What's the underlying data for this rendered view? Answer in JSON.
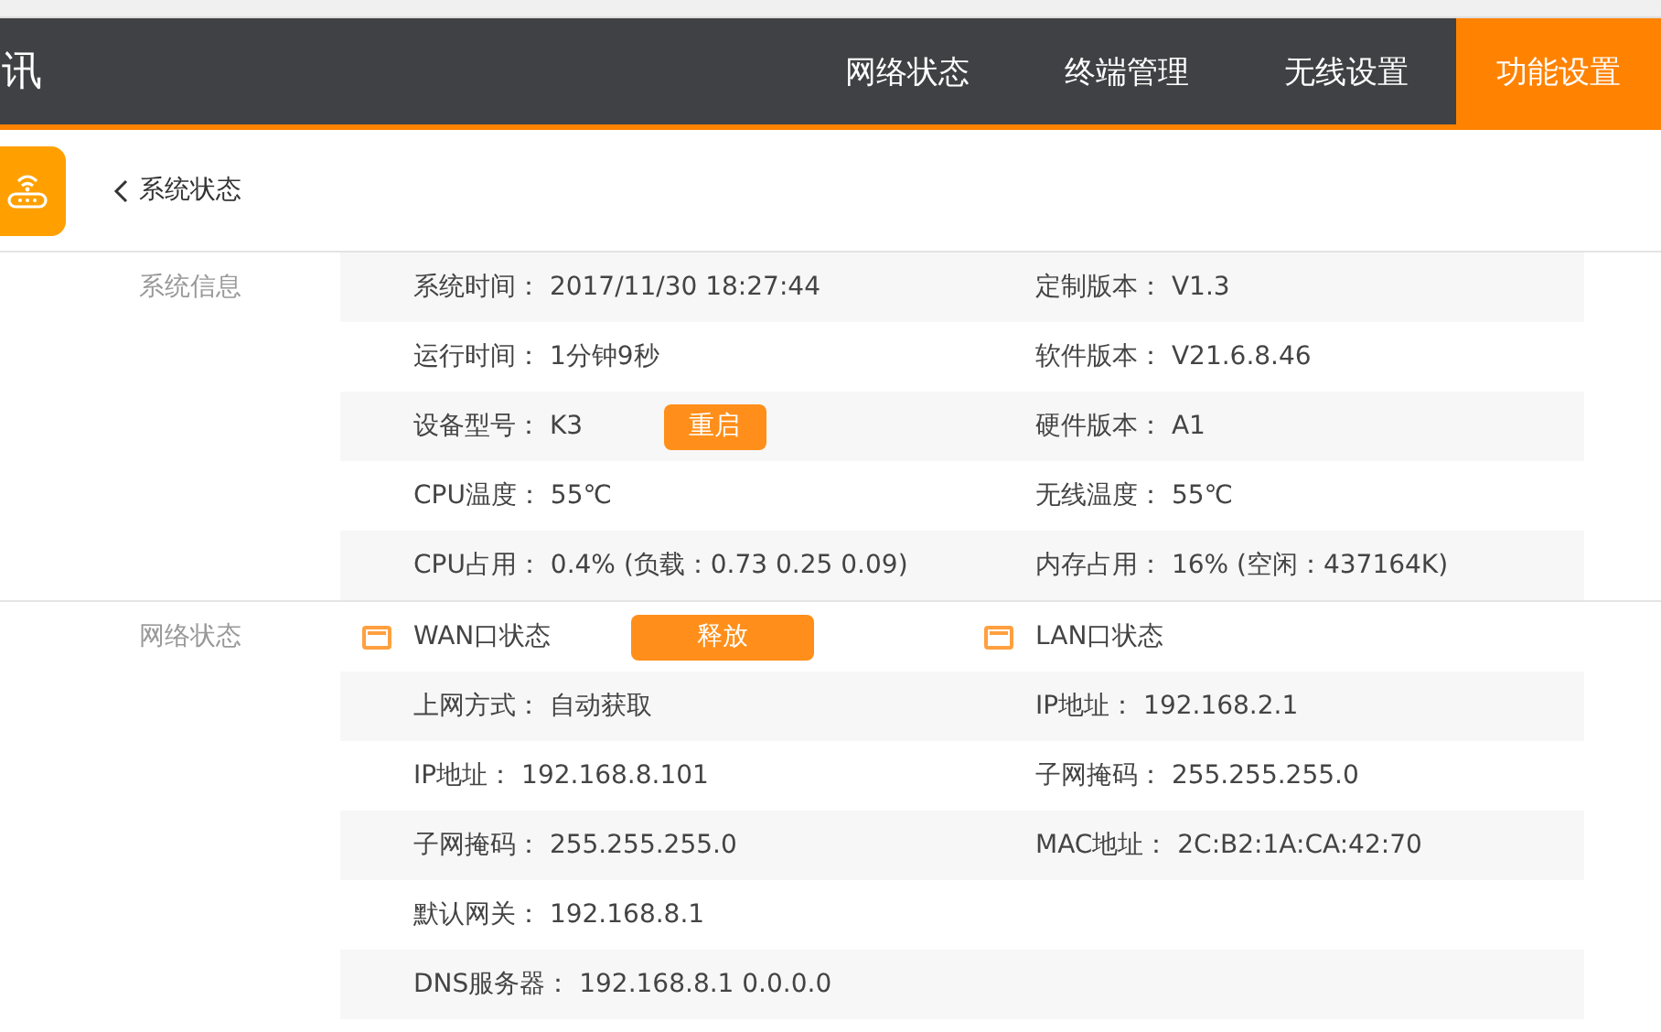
{
  "header": {
    "logo": "讯",
    "nav": [
      {
        "label": "网络状态",
        "selected": false
      },
      {
        "label": "终端管理",
        "selected": false
      },
      {
        "label": "无线设置",
        "selected": false
      },
      {
        "label": "功能设置",
        "selected": true
      }
    ]
  },
  "breadcrumb": {
    "title": "系统状态"
  },
  "system_info": {
    "title": "系统信息",
    "rows": [
      {
        "left": {
          "label": "系统时间：",
          "value": "2017/11/30 18:27:44"
        },
        "right": {
          "label": "定制版本：",
          "value": "V1.3"
        }
      },
      {
        "left": {
          "label": "运行时间：",
          "value": "1分钟9秒"
        },
        "right": {
          "label": "软件版本：",
          "value": "V21.6.8.46"
        }
      },
      {
        "left": {
          "label": "设备型号：",
          "value": "K3",
          "button": "重启"
        },
        "right": {
          "label": "硬件版本：",
          "value": "A1"
        }
      },
      {
        "left": {
          "label": "CPU温度：",
          "value": "55℃"
        },
        "right": {
          "label": "无线温度：",
          "value": "55℃"
        }
      },
      {
        "left": {
          "label": "CPU占用：",
          "value": "0.4% (负载：0.73 0.25 0.09)"
        },
        "right": {
          "label": "内存占用：",
          "value": "16% (空闲：437164K)"
        }
      }
    ]
  },
  "network_status": {
    "title": "网络状态",
    "ports": [
      {
        "title": "WAN口状态",
        "button": "释放"
      },
      {
        "title": "LAN口状态"
      }
    ],
    "rows": [
      {
        "left": {
          "label": "上网方式：",
          "value": "自动获取"
        },
        "right": {
          "label": "IP地址：",
          "value": "192.168.2.1"
        }
      },
      {
        "left": {
          "label": "IP地址：",
          "value": "192.168.8.101"
        },
        "right": {
          "label": "子网掩码：",
          "value": "255.255.255.0"
        }
      },
      {
        "left": {
          "label": "子网掩码：",
          "value": "255.255.255.0"
        },
        "right": {
          "label": "MAC地址：",
          "value": "2C:B2:1A:CA:42:70"
        }
      },
      {
        "left": {
          "label": "默认网关：",
          "value": "192.168.8.1"
        }
      },
      {
        "left": {
          "label": "DNS服务器：",
          "value": "192.168.8.1 0.0.0.0"
        }
      }
    ]
  }
}
